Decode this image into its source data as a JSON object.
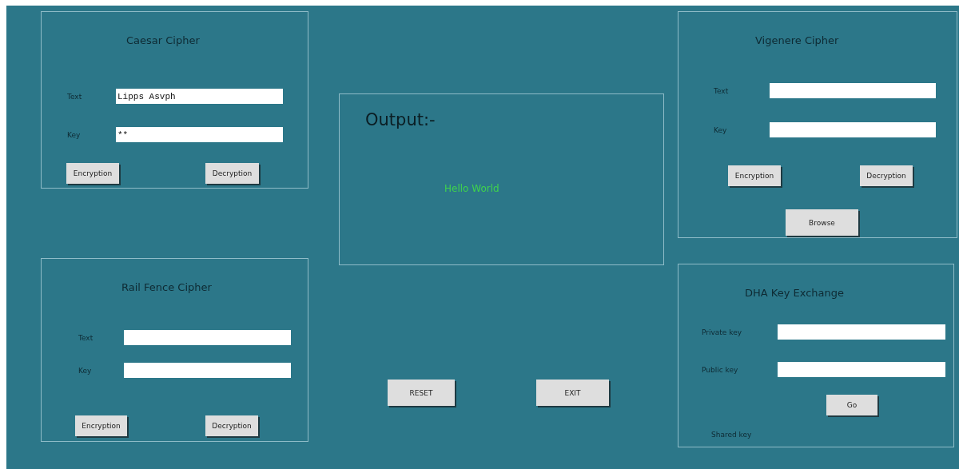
{
  "panels": [
    {
      "title": "Caesar Cipher",
      "fields": [
        {
          "label": "Text",
          "value": "Lipps Asvph"
        },
        {
          "label": "Key",
          "value": "**"
        }
      ],
      "buttons": [
        "Encryption",
        "Decryption"
      ]
    },
    {
      "title": "Rail Fence Cipher",
      "fields": [
        {
          "label": "Text"
        },
        {
          "label": "Key"
        }
      ],
      "buttons": [
        "Encryption",
        "Decryption"
      ]
    },
    {
      "title": "Vigenere Cipher",
      "fields": [
        {
          "label": "Text"
        },
        {
          "label": "Key"
        }
      ],
      "buttons": [
        "Encryption",
        "Decryption"
      ],
      "extra_button": "Browse"
    },
    {
      "title": "DHA Key Exchange",
      "fields": [
        {
          "label": "Private key"
        },
        {
          "label": "Public key"
        }
      ],
      "buttons": [
        "Go"
      ],
      "note": "Shared key"
    }
  ],
  "output": {
    "heading": "Output:-",
    "result": "Hello World"
  },
  "actions": [
    "RESET",
    "EXIT"
  ]
}
